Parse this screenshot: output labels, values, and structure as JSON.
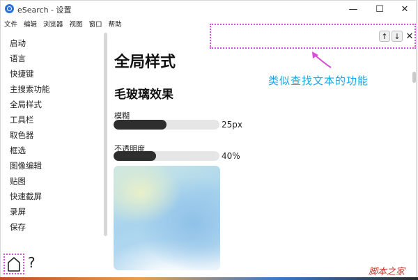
{
  "window": {
    "title": "eSearch - 设置",
    "controls": {
      "minimize": "—",
      "maximize": "☐",
      "close": "✕"
    }
  },
  "menubar": [
    "文件",
    "编辑",
    "浏览器",
    "视图",
    "窗口",
    "帮助"
  ],
  "sidebar": {
    "items": [
      {
        "label": "启动"
      },
      {
        "label": "语言"
      },
      {
        "label": "快捷键"
      },
      {
        "label": "主搜索功能"
      },
      {
        "label": "全局样式"
      },
      {
        "label": "工具栏"
      },
      {
        "label": "取色器"
      },
      {
        "label": "框选"
      },
      {
        "label": "图像编辑"
      },
      {
        "label": "贴图"
      },
      {
        "label": "快速截屏"
      },
      {
        "label": "录屏"
      },
      {
        "label": "保存"
      }
    ]
  },
  "main": {
    "page_title": "全局样式",
    "section_title": "毛玻璃效果",
    "blur": {
      "label": "模糊",
      "value_text": "25px",
      "fraction": 0.5
    },
    "opacity": {
      "label": "不透明度",
      "value_text": "40%",
      "fraction": 0.4
    }
  },
  "findbar": {
    "placeholder": "",
    "up": "↑",
    "down": "↓",
    "close": "✕"
  },
  "annotation": {
    "text": "类似查找文本的功能"
  },
  "footer": {
    "help": "?"
  },
  "watermark": "脚本之家",
  "colors": {
    "accent_annotation": "#d74fd6",
    "annotation_text": "#1aa7e6",
    "slider_fill": "#2e2e2e",
    "slider_track": "#e6e6e6"
  }
}
